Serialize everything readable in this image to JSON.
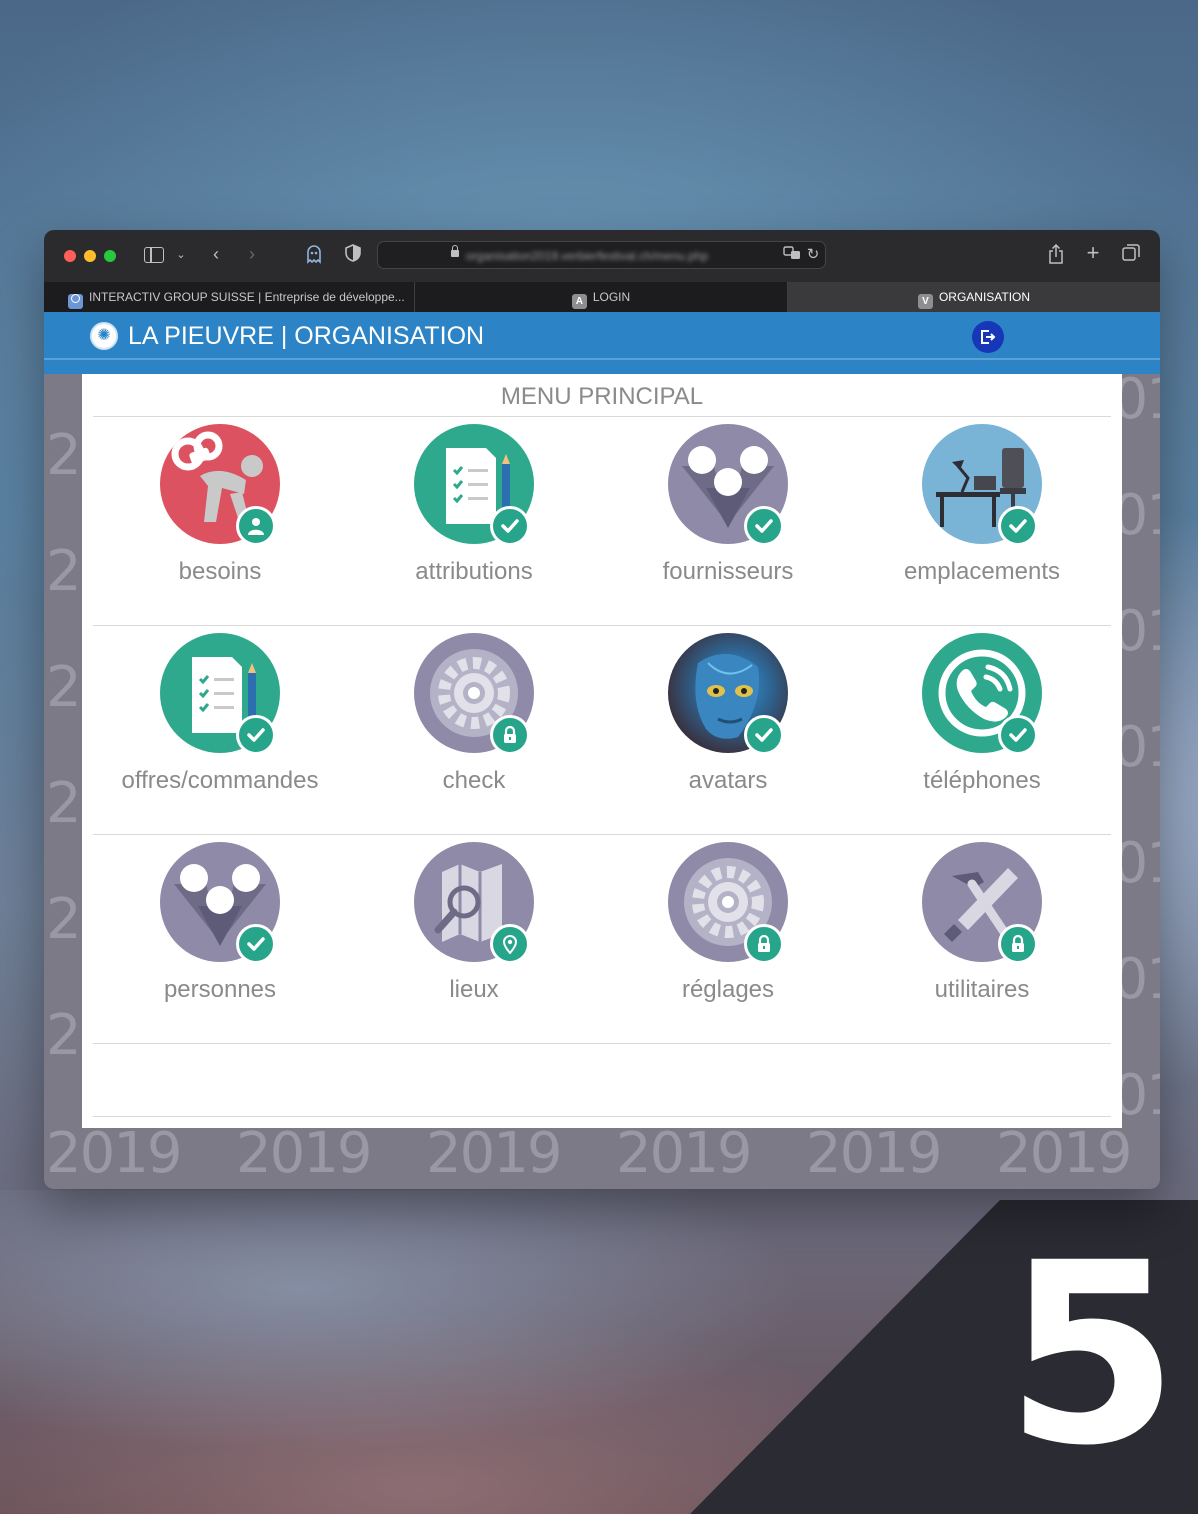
{
  "browser": {
    "url": "organisation2019.verbierfestival.ch/menu.php",
    "tabs": [
      {
        "label": "INTERACTIV GROUP SUISSE | Entreprise de développe...",
        "favicon": ""
      },
      {
        "label": "LOGIN",
        "favicon": "A"
      },
      {
        "label": "ORGANISATION",
        "favicon": "V",
        "active": true
      }
    ]
  },
  "app": {
    "title": "LA PIEUVRE | ORGANISATION",
    "logo_icon": "octopus-icon",
    "logout_icon": "logout-icon",
    "header_color": "#2c84c6"
  },
  "menu": {
    "title": "MENU PRINCIPAL",
    "tiles": [
      {
        "label": "besoins",
        "icon": "doll-worker-icon",
        "badge": "user-icon"
      },
      {
        "label": "attributions",
        "icon": "checklist-icon",
        "badge": "check-icon"
      },
      {
        "label": "fournisseurs",
        "icon": "people-icon",
        "badge": "check-icon"
      },
      {
        "label": "emplacements",
        "icon": "desk-icon",
        "badge": "check-icon"
      },
      {
        "label": "offres/commandes",
        "icon": "checklist-icon",
        "badge": "check-icon"
      },
      {
        "label": "check",
        "icon": "gear-icon",
        "badge": "lock-icon"
      },
      {
        "label": "avatars",
        "icon": "avatar-photo",
        "badge": "check-icon"
      },
      {
        "label": "téléphones",
        "icon": "phone-icon",
        "badge": "check-icon"
      },
      {
        "label": "personnes",
        "icon": "people-icon",
        "badge": "check-icon"
      },
      {
        "label": "lieux",
        "icon": "map-search-icon",
        "badge": "location-pin-icon"
      },
      {
        "label": "réglages",
        "icon": "gear-icon",
        "badge": "lock-icon"
      },
      {
        "label": "utilitaires",
        "icon": "tools-icon",
        "badge": "lock-icon"
      }
    ]
  },
  "watermark": {
    "text": "2019"
  },
  "slide_number": "5"
}
